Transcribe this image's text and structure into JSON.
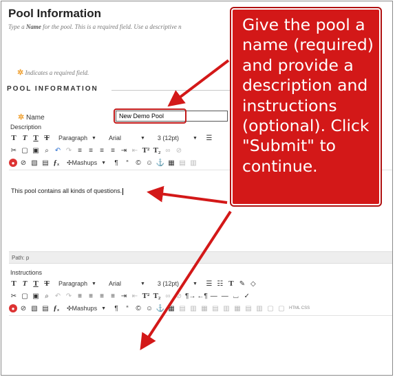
{
  "page": {
    "title": "Pool Information",
    "subtitle_prefix": "Type a ",
    "subtitle_bold": "Name",
    "subtitle_suffix": " for the pool. This is a required field. Use a descriptive n",
    "required_note": "Indicates a required field.",
    "required_star": "✲"
  },
  "section": {
    "heading": "POOL INFORMATION"
  },
  "name_field": {
    "label": "Name",
    "value": "New Demo Pool"
  },
  "description": {
    "label": "Description",
    "toolbar1": {
      "text_buttons": [
        "T",
        "T",
        "T",
        "T"
      ],
      "paragraph_select": "Paragraph",
      "font_select": "Arial",
      "size_select": "3 (12pt)"
    },
    "mashups_label": "Mashups",
    "content": "This pool contains all kinds of questions.",
    "path": "Path: p"
  },
  "instructions": {
    "label": "Instructions",
    "toolbar1": {
      "text_buttons": [
        "T",
        "T",
        "T",
        "T"
      ],
      "paragraph_select": "Paragraph",
      "font_select": "Arial",
      "size_select": "3 (12pt)"
    },
    "mashups_label": "Mashups",
    "html_label": "HTML CSS"
  },
  "callout": {
    "text": "Give the pool a name (required) and provide a description and instructions (optional). Click \"Submit\" to continue."
  },
  "colors": {
    "callout": "#d31818",
    "arrow": "#d31818",
    "required_star": "#f0a030"
  }
}
